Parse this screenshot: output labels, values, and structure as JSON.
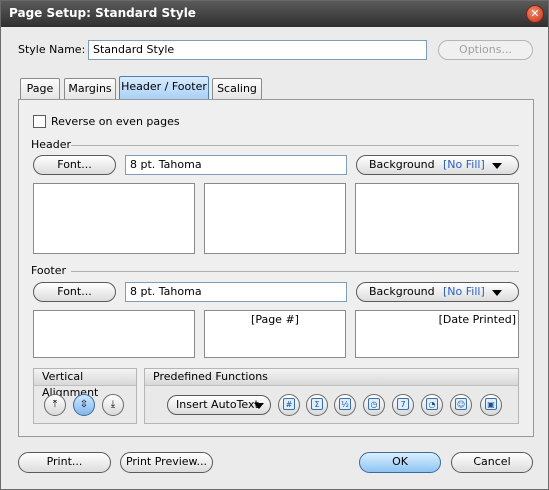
{
  "window": {
    "title": "Page Setup: Standard Style",
    "close_glyph": "✕"
  },
  "style_name": {
    "label": "Style Name:",
    "value": "Standard Style",
    "options_label": "Options..."
  },
  "tabs": [
    {
      "label": "Page"
    },
    {
      "label": "Margins"
    },
    {
      "label": "Header / Footer",
      "active": true
    },
    {
      "label": "Scaling"
    }
  ],
  "reverse_checkbox": {
    "label": "Reverse on even pages",
    "checked": false
  },
  "header": {
    "section_label": "Header",
    "font_button": "Font...",
    "font_value": "8 pt. Tahoma",
    "background_label": "Background",
    "background_value": "[No Fill]",
    "left_text": "",
    "center_text": "",
    "right_text": ""
  },
  "footer": {
    "section_label": "Footer",
    "font_button": "Font...",
    "font_value": "8 pt. Tahoma",
    "background_label": "Background",
    "background_value": "[No Fill]",
    "left_text": "",
    "center_text": "[Page #]",
    "right_text": "[Date Printed]"
  },
  "vertical_alignment": {
    "title": "Vertical Alignment",
    "buttons": [
      "align-top-icon",
      "align-middle-icon",
      "align-bottom-icon"
    ],
    "glyphs": [
      "⤒",
      "⇳",
      "⤓"
    ],
    "selected": "align-middle-icon"
  },
  "predefined_functions": {
    "title": "Predefined Functions",
    "insert_autotext": "Insert AutoText",
    "icons": [
      {
        "name": "page-number-icon",
        "glyph": "#"
      },
      {
        "name": "total-pages-icon",
        "glyph": "Σ"
      },
      {
        "name": "page-of-pages-icon",
        "glyph": "½"
      },
      {
        "name": "date-time-icon",
        "glyph": "◷"
      },
      {
        "name": "date-printed-icon",
        "glyph": "7"
      },
      {
        "name": "time-printed-icon",
        "glyph": "◔"
      },
      {
        "name": "user-name-icon",
        "glyph": "☺"
      },
      {
        "name": "computer-name-icon",
        "glyph": "▣"
      }
    ]
  },
  "buttons": {
    "print": "Print...",
    "print_preview": "Print Preview...",
    "ok": "OK",
    "cancel": "Cancel"
  }
}
